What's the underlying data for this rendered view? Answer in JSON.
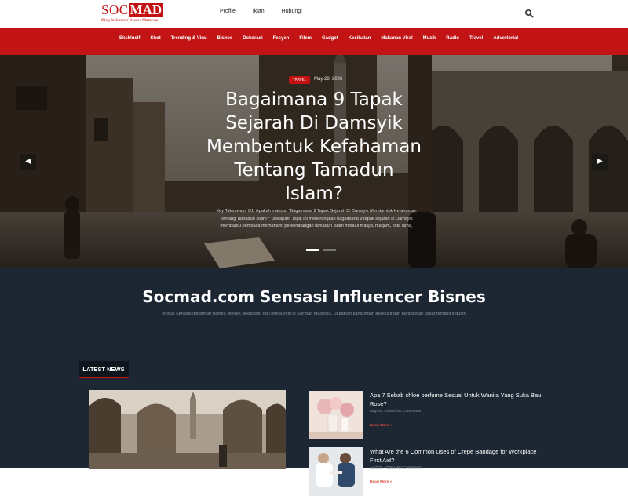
{
  "header": {
    "logo_main_left": "SOC",
    "logo_main_right": "MAD",
    "logo_tagline": "Blog Influencer Bisnes Malaysia",
    "nav": [
      "Profile",
      "Iklan",
      "Hubungi"
    ]
  },
  "categories": [
    "Eksklusif",
    "Shot",
    "Trending & Viral",
    "Bisnes",
    "Dekorasi",
    "Fesyen",
    "Filem",
    "Gadget",
    "Kesihatan",
    "Makanan Viral",
    "Muzik",
    "Radio",
    "Travel",
    "Advertorial"
  ],
  "hero": {
    "badge": "Travel",
    "date": "May 28, 2026",
    "title": "Bagaimana 9 Tapak Sejarah Di Damsyik Membentuk Kefahaman Tentang Tamadun Islam?",
    "excerpt": "Key Takeaways Q1: Apakah maksud “Bagaimana 9 Tapak Sejarah Di Damsyik Membentuk Kefahaman Tentang Tamadun Islam?” Jawapan: Topik ini menerangkan bagaimana 9 tapak sejarah di Damsyik membantu pembaca memahami perkembangan tamadun Islam melalui masjid, maqam, kota lama,",
    "prev_arrow": "◀",
    "next_arrow": "▶"
  },
  "site": {
    "heading": "Socmad.com Sensasi Influencer Bisnes",
    "subheading": "Terokai Sensasi Influencer Bisnes, fesyen, teknologi, dan berita viral di Socmad Malaysia. Dapatkan kandungan eksklusif dan pandangan pakar tentang industri."
  },
  "latest_news": {
    "label": "LATEST NEWS",
    "items": [
      {
        "title": "Apa 7 Sebab chloe perfume Sesuai Untuk Wanita Yang Suka Bau Rose?",
        "meta": "May 28, 2026 // No Comments",
        "more": "Read More »"
      },
      {
        "title": "What Are the 6 Common Uses of Crepe Bandage for Workplace First Aid?",
        "meta": "April 30, 2026 // No Comments",
        "more": "Read More »"
      }
    ]
  },
  "colors": {
    "brand_red": "#c41010",
    "category_bar": "#c21414",
    "dark_section": "#1c2733",
    "read_more": "#e04a3a"
  },
  "icons": {
    "search": "search-icon",
    "prev": "chevron-left-icon",
    "next": "chevron-right-icon"
  }
}
